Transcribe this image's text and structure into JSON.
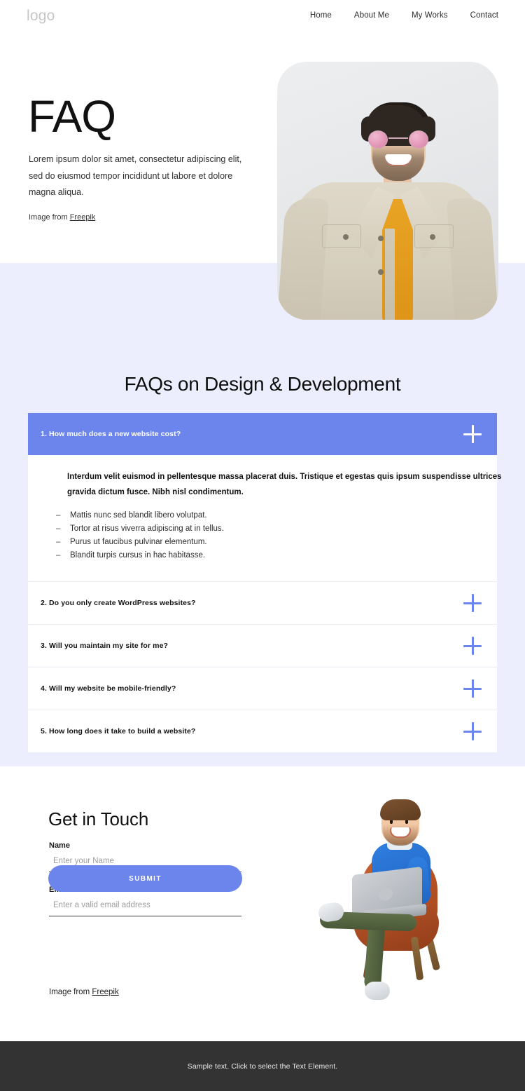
{
  "header": {
    "logo": "logo",
    "nav": [
      {
        "label": "Home"
      },
      {
        "label": "About Me"
      },
      {
        "label": "My Works"
      },
      {
        "label": "Contact"
      }
    ]
  },
  "hero": {
    "title": "FAQ",
    "paragraph": "Lorem ipsum dolor sit amet, consectetur adipiscing elit, sed do eiusmod tempor incididunt ut labore et dolore magna aliqua.",
    "credit_prefix": "Image from ",
    "credit_link": "Freepik",
    "image_alt": "smiling-man-in-beige-denim-jacket-with-pink-round-sunglasses"
  },
  "faq": {
    "heading": "FAQs on Design & Development",
    "items": [
      {
        "question": "1. How much does a new website cost?",
        "expanded": true,
        "answer_lead": "Interdum velit euismod in pellentesque massa placerat duis. Tristique et egestas quis ipsum suspendisse ultrices gravida dictum fusce. Nibh nisl condimentum.",
        "answer_bullets": [
          "Mattis nunc sed blandit libero volutpat.",
          "Tortor at risus viverra adipiscing at in tellus.",
          "Purus ut faucibus pulvinar elementum.",
          "Blandit turpis cursus in hac habitasse."
        ]
      },
      {
        "question": "2. Do you only create WordPress websites?",
        "expanded": false
      },
      {
        "question": "3. Will you maintain my site for me?",
        "expanded": false
      },
      {
        "question": "4. Will my website be mobile-friendly?",
        "expanded": false
      },
      {
        "question": "5. How long does it take to build a website?",
        "expanded": false
      }
    ]
  },
  "contact": {
    "title": "Get in Touch",
    "name_label": "Name",
    "name_placeholder": "Enter your Name",
    "name_value": "",
    "email_label": "Email",
    "email_placeholder": "Enter a valid email address",
    "email_value": "",
    "submit_label": "SUBMIT",
    "credit_prefix": "Image from ",
    "credit_link": "Freepik",
    "image_alt": "3d-character-sitting-in-armchair-with-laptop"
  },
  "footer": {
    "text": "Sample text. Click to select the Text Element."
  },
  "colors": {
    "accent": "#6c85ec",
    "section_bg": "#eceefd",
    "footer_bg": "#333333",
    "page_bg": "#ffffff",
    "logo_gray": "#c6c6c6"
  }
}
